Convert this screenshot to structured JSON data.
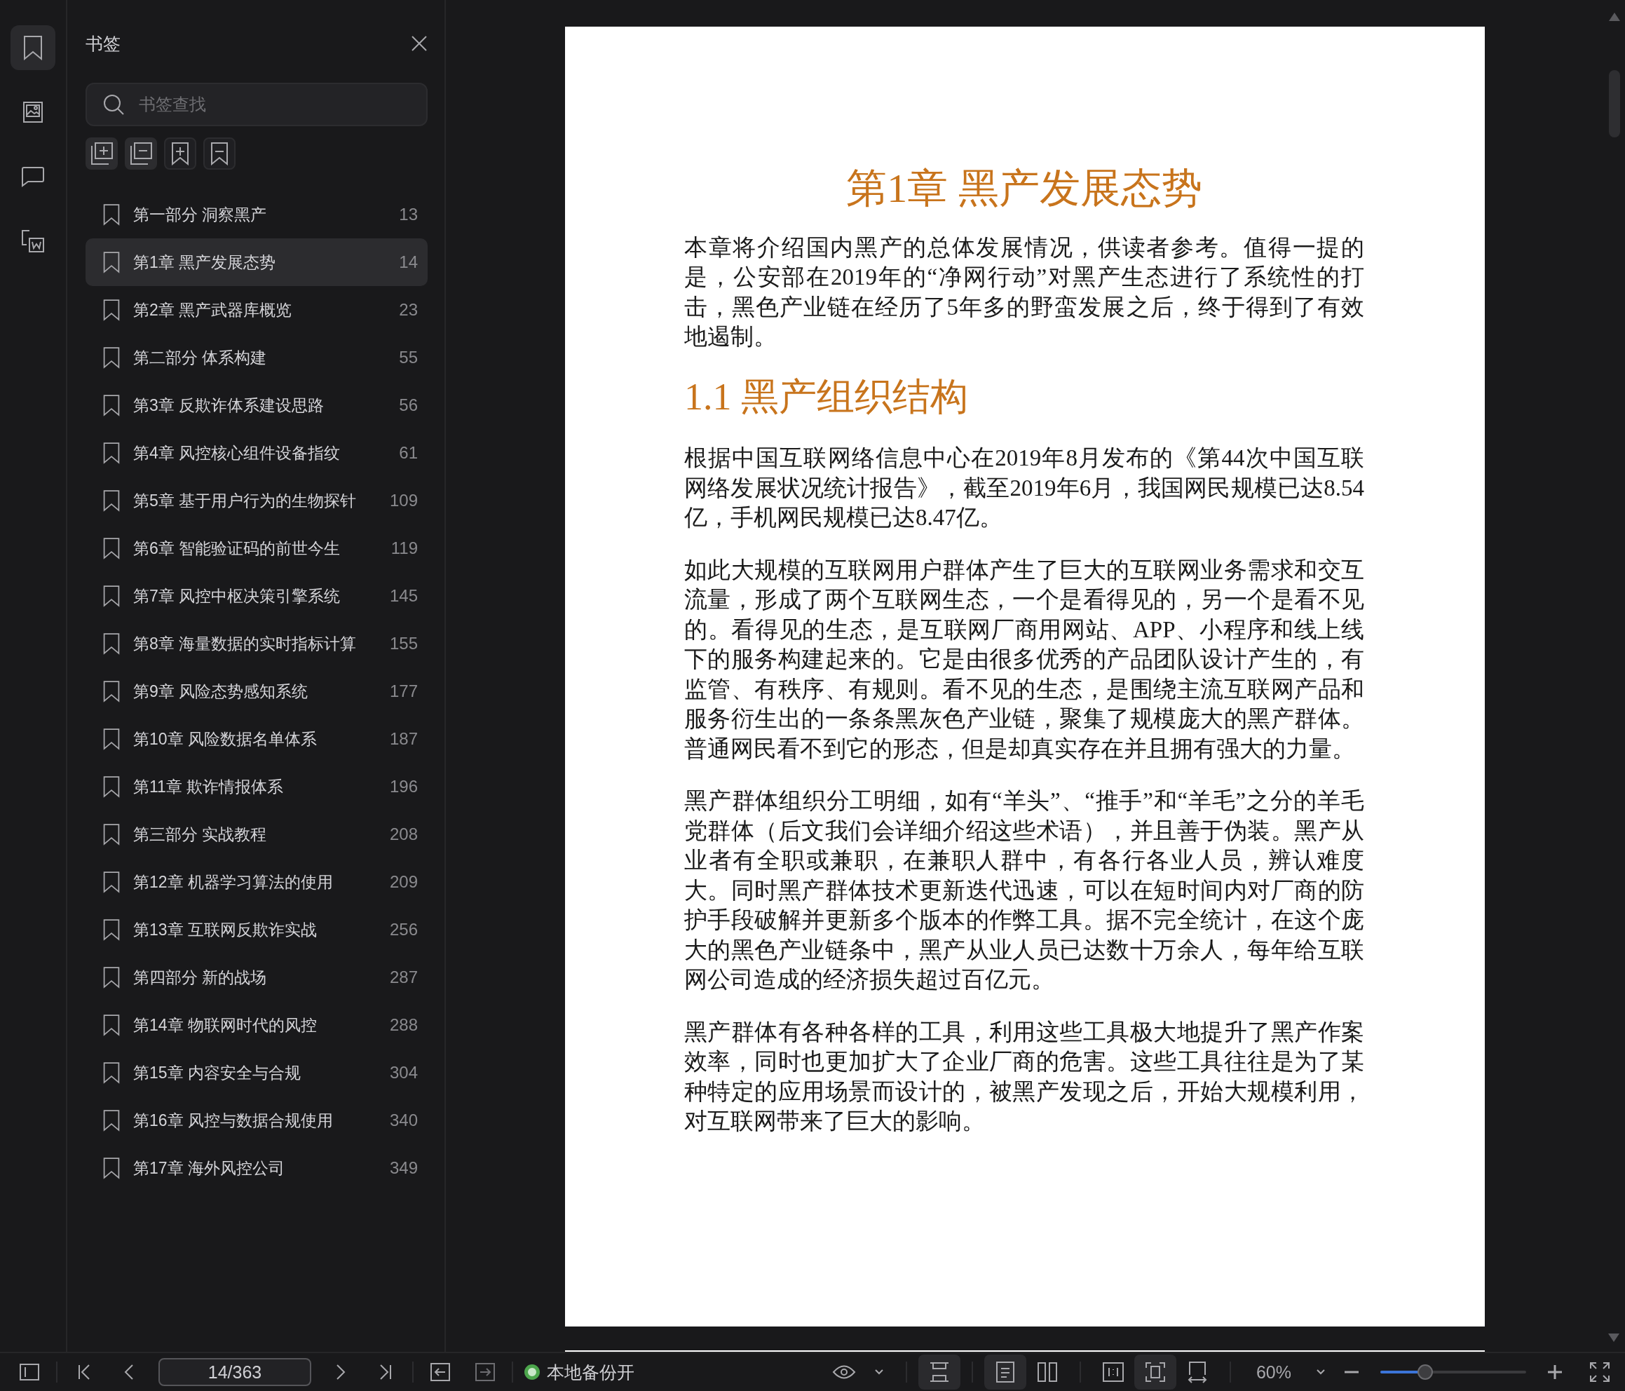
{
  "rail": [
    {
      "kind": "bookmarks",
      "selected": true
    },
    {
      "kind": "thumbnails",
      "selected": false
    },
    {
      "kind": "comments",
      "selected": false
    },
    {
      "kind": "convert",
      "selected": false
    }
  ],
  "sidebar": {
    "title": "书签",
    "search": {
      "placeholder": "书签查找"
    },
    "bookmarks": [
      {
        "label": "第一部分 洞察黑产",
        "page": "13",
        "selected": false
      },
      {
        "label": "第1章 黑产发展态势",
        "page": "14",
        "selected": true
      },
      {
        "label": "第2章 黑产武器库概览",
        "page": "23",
        "selected": false
      },
      {
        "label": "第二部分 体系构建",
        "page": "55",
        "selected": false
      },
      {
        "label": "第3章 反欺诈体系建设思路",
        "page": "56",
        "selected": false
      },
      {
        "label": "第4章 风控核心组件设备指纹",
        "page": "61",
        "selected": false
      },
      {
        "label": "第5章 基于用户行为的生物探针",
        "page": "109",
        "selected": false
      },
      {
        "label": "第6章 智能验证码的前世今生",
        "page": "119",
        "selected": false
      },
      {
        "label": "第7章 风控中枢决策引擎系统",
        "page": "145",
        "selected": false
      },
      {
        "label": "第8章 海量数据的实时指标计算",
        "page": "155",
        "selected": false
      },
      {
        "label": "第9章 风险态势感知系统",
        "page": "177",
        "selected": false
      },
      {
        "label": "第10章 风险数据名单体系",
        "page": "187",
        "selected": false
      },
      {
        "label": "第11章 欺诈情报体系",
        "page": "196",
        "selected": false
      },
      {
        "label": "第三部分 实战教程",
        "page": "208",
        "selected": false
      },
      {
        "label": "第12章 机器学习算法的使用",
        "page": "209",
        "selected": false
      },
      {
        "label": "第13章 互联网反欺诈实战",
        "page": "256",
        "selected": false
      },
      {
        "label": "第四部分 新的战场",
        "page": "287",
        "selected": false
      },
      {
        "label": "第14章 物联网时代的风控",
        "page": "288",
        "selected": false
      },
      {
        "label": "第15章 内容安全与合规",
        "page": "304",
        "selected": false
      },
      {
        "label": "第16章 风控与数据合规使用",
        "page": "340",
        "selected": false
      },
      {
        "label": "第17章 海外风控公司",
        "page": "349",
        "selected": false
      }
    ]
  },
  "page": {
    "blocks": [
      {
        "kind": "title",
        "text": "第1章 黑产发展态势"
      },
      {
        "kind": "paragraph",
        "text": "本章将介绍国内黑产的总体发展情况，供读者参考。值得一提的是，公安部在2019年的“净网行动”对黑产生态进行了系统性的打击，黑色产业链在经历了5年多的野蛮发展之后，终于得到了有效地遏制。"
      },
      {
        "kind": "heading",
        "text": "1.1 黑产组织结构"
      },
      {
        "kind": "paragraph",
        "text": "根据中国互联网络信息中心在2019年8月发布的《第44次中国互联网络发展状况统计报告》，截至2019年6月，我国网民规模已达8.54亿，手机网民规模已达8.47亿。"
      },
      {
        "kind": "paragraph",
        "text": "如此大规模的互联网用户群体产生了巨大的互联网业务需求和交互流量，形成了两个互联网生态，一个是看得见的，另一个是看不见的。看得见的生态，是互联网厂商用网站、APP、小程序和线上线下的服务构建起来的。它是由很多优秀的产品团队设计产生的，有监管、有秩序、有规则。看不见的生态，是围绕主流互联网产品和服务衍生出的一条条黑灰色产业链，聚集了规模庞大的黑产群体。普通网民看不到它的形态，但是却真实存在并且拥有强大的力量。"
      },
      {
        "kind": "paragraph",
        "text": "黑产群体组织分工明细，如有“羊头”、“推手”和“羊毛”之分的羊毛党群体（后文我们会详细介绍这些术语），并且善于伪装。黑产从业者有全职或兼职，在兼职人群中，有各行各业人员，辨认难度大。同时黑产群体技术更新迭代迅速，可以在短时间内对厂商的防护手段破解并更新多个版本的作弊工具。据不完全统计，在这个庞大的黑色产业链条中，黑产从业人员已达数十万余人，每年给互联网公司造成的经济损失超过百亿元。"
      },
      {
        "kind": "paragraph",
        "text": "黑产群体有各种各样的工具，利用这些工具极大地提升了黑产作案效率，同时也更加扩大了企业厂商的危害。这些工具往往是为了某种特定的应用场景而设计的，被黑产发现之后，开始大规模利用，对互联网带来了巨大的影响。"
      }
    ]
  },
  "status_bar": {
    "page_field": "14/363",
    "backup": {
      "label": "本地备份开",
      "on": true
    },
    "view_buttons": [
      {
        "kind": "scroll",
        "selected": true
      },
      {
        "kind": "single",
        "selected": true
      },
      {
        "kind": "double",
        "selected": false
      },
      {
        "kind": "actual",
        "selected": false
      },
      {
        "kind": "fit",
        "selected": true
      },
      {
        "kind": "width",
        "selected": false
      }
    ],
    "zoom": {
      "value": "60%",
      "level": 0.31
    }
  }
}
